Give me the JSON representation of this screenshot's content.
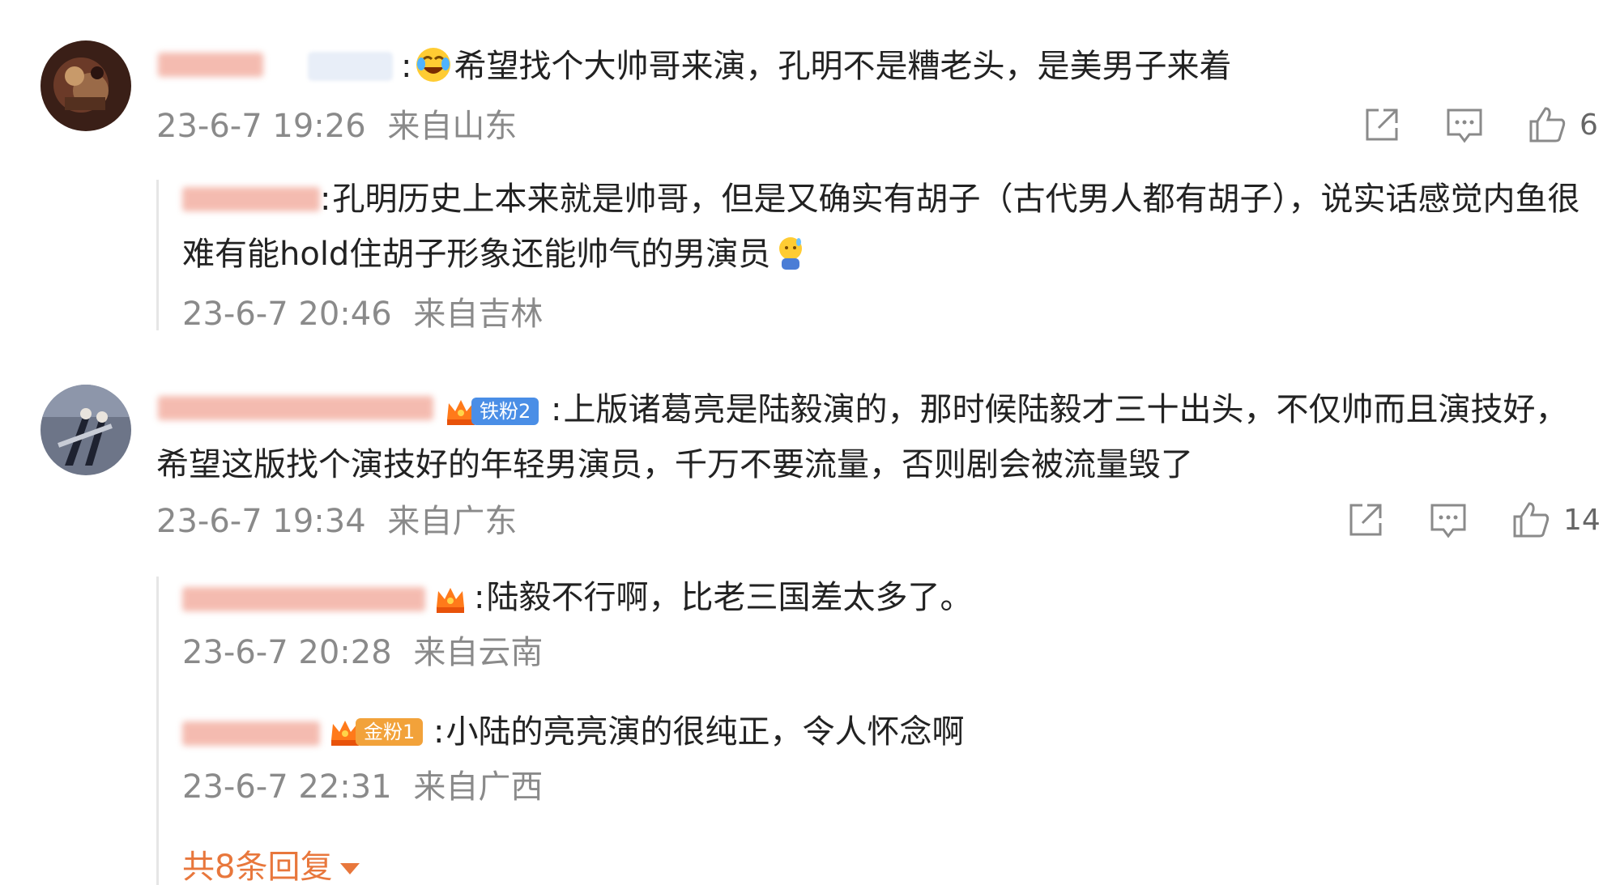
{
  "comments": [
    {
      "text": "希望找个大帅哥来演，孔明不是糟老头，是美男子来着",
      "date": "23-6-7 19:26",
      "location": "来自山东",
      "like_count": "6",
      "replies": [
        {
          "text": "孔明历史上本来就是帅哥，但是又确实有胡子（古代男人都有胡子），说实话感觉内鱼很难有能hold住胡子形象还能帅气的男演员",
          "date": "23-6-7 20:46",
          "location": "来自吉林"
        }
      ]
    },
    {
      "badge": "铁粉2",
      "text": "上版诸葛亮是陆毅演的，那时候陆毅才三十出头，不仅帅而且演技好，希望这版找个演技好的年轻男演员，千万不要流量，否则剧会被流量毁了",
      "date": "23-6-7 19:34",
      "location": "来自广东",
      "like_count": "14",
      "replies": [
        {
          "text": "陆毅不行啊，比老三国差太多了。",
          "date": "23-6-7 20:28",
          "location": "来自云南"
        },
        {
          "badge": "金粉1",
          "text": "小陆的亮亮演的很纯正，令人怀念啊",
          "date": "23-6-7 22:31",
          "location": "来自广西"
        }
      ],
      "more_replies": "共8条回复"
    }
  ],
  "colors": {
    "meta_gray": "#8a8a8a",
    "link_orange": "#e8773c",
    "iron_badge": "#4a8ee6",
    "gold_badge": "#f2a23a"
  },
  "icons": [
    "share-icon",
    "comment-icon",
    "like-icon",
    "laugh-cry-emoji",
    "sweat-emoji",
    "crown-badge-icon",
    "caret-down-icon"
  ]
}
